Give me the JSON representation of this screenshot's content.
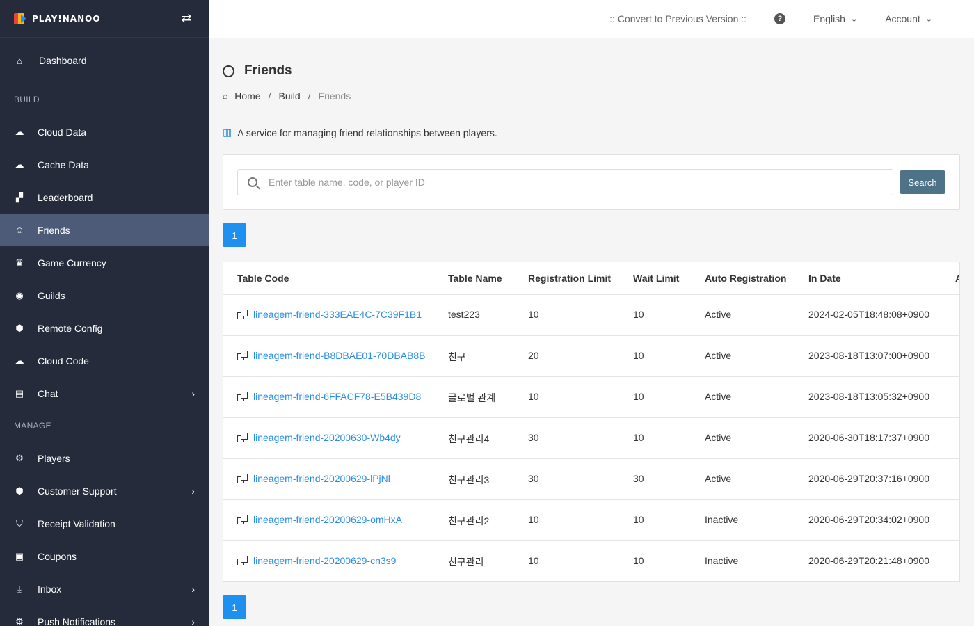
{
  "brand": {
    "name": "PLAY!NANOO"
  },
  "sidebar": {
    "dashboard": "Dashboard",
    "sections": [
      {
        "label": "BUILD",
        "items": [
          {
            "label": "Cloud Data",
            "icon": "cloud-upload-icon"
          },
          {
            "label": "Cache Data",
            "icon": "cloud-upload-icon"
          },
          {
            "label": "Leaderboard",
            "icon": "sitemap-icon"
          },
          {
            "label": "Friends",
            "icon": "users-icon",
            "active": true
          },
          {
            "label": "Game Currency",
            "icon": "crown-icon"
          },
          {
            "label": "Guilds",
            "icon": "database-icon"
          },
          {
            "label": "Remote Config",
            "icon": "cube-icon"
          },
          {
            "label": "Cloud Code",
            "icon": "cloud-download-icon"
          },
          {
            "label": "Chat",
            "icon": "comments-icon",
            "chevron": true
          }
        ]
      },
      {
        "label": "MANAGE",
        "items": [
          {
            "label": "Players",
            "icon": "user-cog-icon"
          },
          {
            "label": "Customer Support",
            "icon": "question-shield-icon",
            "chevron": true
          },
          {
            "label": "Receipt Validation",
            "icon": "check-shield-icon"
          },
          {
            "label": "Coupons",
            "icon": "ticket-icon"
          },
          {
            "label": "Inbox",
            "icon": "inbox-icon",
            "chevron": true
          },
          {
            "label": "Push Notifications",
            "icon": "gear-icon",
            "chevron": true
          }
        ]
      }
    ]
  },
  "topbar": {
    "convert": ":: Convert to Previous Version ::",
    "language": "English",
    "account": "Account"
  },
  "page": {
    "title": "Friends",
    "breadcrumb": [
      "Home",
      "Build",
      "Friends"
    ],
    "description": "A service for managing friend relationships between players."
  },
  "search": {
    "placeholder": "Enter table name, code, or player ID",
    "button": "Search"
  },
  "pagination": {
    "current": "1"
  },
  "table": {
    "columns": [
      "Table Code",
      "Table Name",
      "Registration Limit",
      "Wait Limit",
      "Auto Registration",
      "In Date",
      "A"
    ],
    "rows": [
      [
        "lineagem-friend-333EAE4C-7C39F1B1",
        "test223",
        "10",
        "10",
        "Active",
        "2024-02-05T18:48:08+0900"
      ],
      [
        "lineagem-friend-B8DBAE01-70DBAB8B",
        "친구",
        "20",
        "10",
        "Active",
        "2023-08-18T13:07:00+0900"
      ],
      [
        "lineagem-friend-6FFACF78-E5B439D8",
        "글로벌 관계",
        "10",
        "10",
        "Active",
        "2023-08-18T13:05:32+0900"
      ],
      [
        "lineagem-friend-20200630-Wb4dy",
        "친구관리4",
        "30",
        "10",
        "Active",
        "2020-06-30T18:17:37+0900"
      ],
      [
        "lineagem-friend-20200629-lPjNl",
        "친구관리3",
        "30",
        "30",
        "Active",
        "2020-06-29T20:37:16+0900"
      ],
      [
        "lineagem-friend-20200629-omHxA",
        "친구관리2",
        "10",
        "10",
        "Inactive",
        "2020-06-29T20:34:02+0900"
      ],
      [
        "lineagem-friend-20200629-cn3s9",
        "친구관리",
        "10",
        "10",
        "Inactive",
        "2020-06-29T20:21:48+0900"
      ]
    ]
  }
}
